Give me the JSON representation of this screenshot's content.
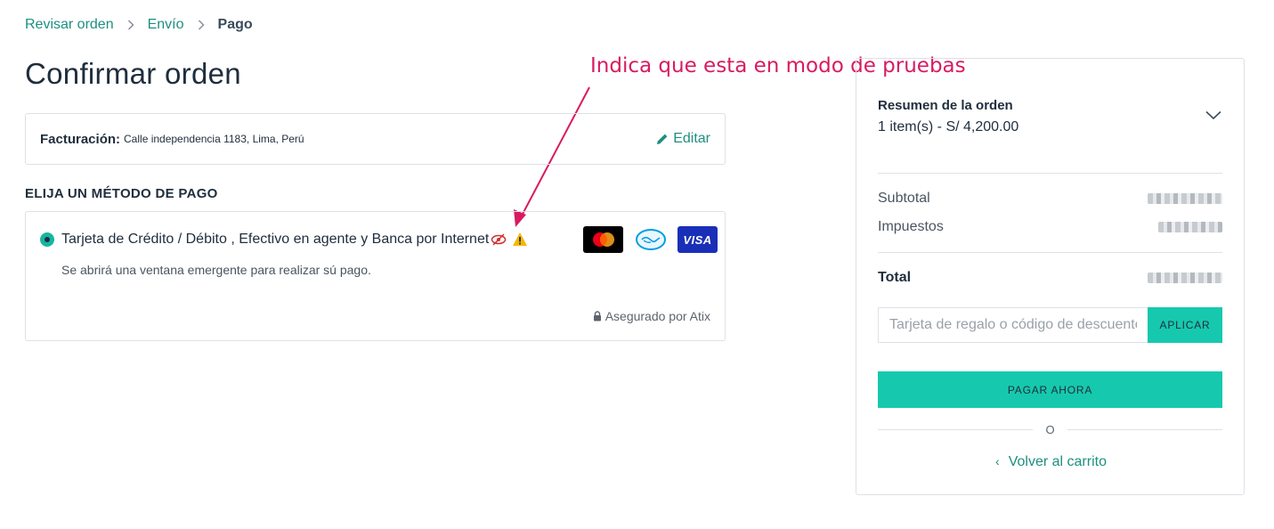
{
  "breadcrumb": {
    "items": [
      "Revisar orden",
      "Envío"
    ],
    "current": "Pago"
  },
  "page_title": "Confirmar orden",
  "annotation": {
    "text": "Indica que esta en modo de pruebas",
    "color": "#d81b60"
  },
  "billing": {
    "label": "Facturación:",
    "address": "Calle independencia 1183, Lima, Perú",
    "edit_label": "Editar"
  },
  "payment_section": {
    "title": "ELIJA UN MÉTODO DE PAGO",
    "method_label": "Tarjeta de Crédito / Débito , Efectivo en agente y Banca por Internet",
    "note": "Se abrirá una ventana emergente para realizar sú pago.",
    "secured_by": "Asegurado por Atix",
    "card_logos": [
      "mastercard-logo",
      "mercadopago-logo",
      "visa-logo"
    ],
    "visa_text": "VISA",
    "selected": true
  },
  "summary": {
    "title": "Resumen de la orden",
    "items_text": "1 item(s) -  S/ 4,200.00",
    "subtotal_label": "Subtotal",
    "taxes_label": "Impuestos",
    "total_label": "Total",
    "coupon_placeholder": "Tarjeta de regalo o código de descuento",
    "apply_label": "APLICAR",
    "pay_label": "PAGAR AHORA",
    "or_text": "O",
    "back_label": "Volver al carrito"
  },
  "colors": {
    "accent": "#16c9ae",
    "link": "#1e8f80",
    "text": "#1f2d3d",
    "warning": "#f5b800"
  }
}
